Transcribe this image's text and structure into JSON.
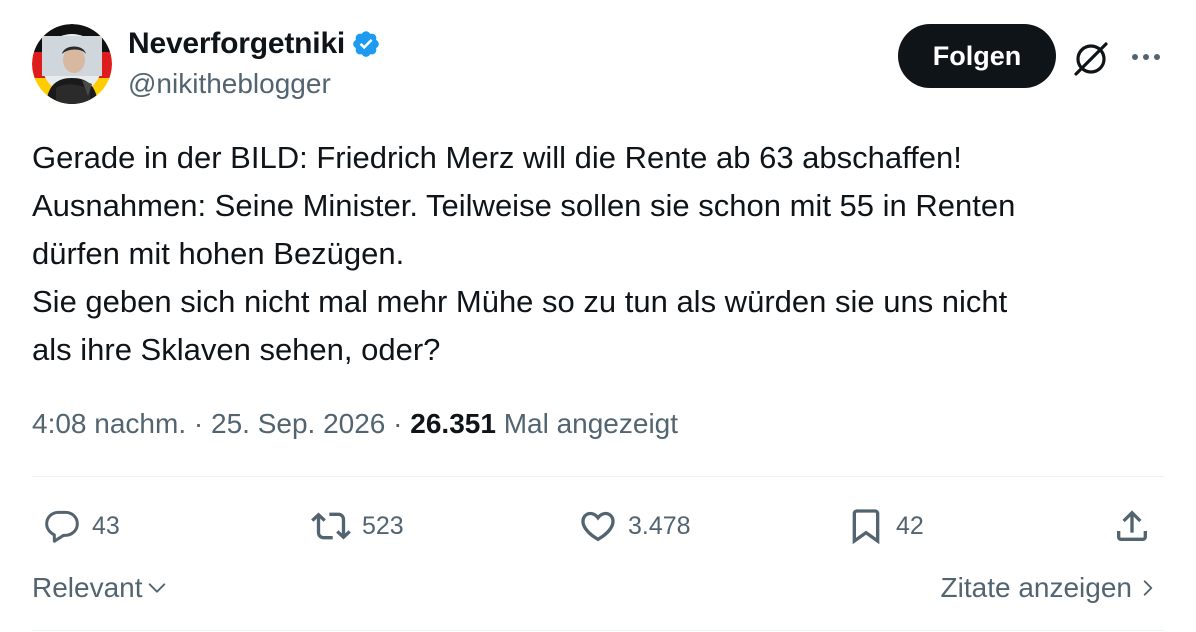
{
  "author": {
    "display_name": "Neverforgetniki",
    "handle": "@nikitheblogger",
    "verified": true,
    "avatar_icon": "user-avatar-photo"
  },
  "header": {
    "follow_label": "Folgen",
    "grok_icon": "grok-icon",
    "more_icon": "more-horizontal-icon"
  },
  "tweet": {
    "lines": [
      "Gerade in der BILD: Friedrich Merz will die Rente ab 63 abschaffen!",
      "Ausnahmen: Seine Minister. Teilweise sollen sie schon mit 55 in Renten",
      "dürfen mit hohen Bezügen.",
      "Sie geben sich nicht mal mehr Mühe so zu tun als würden sie uns nicht",
      "als ihre Sklaven sehen, oder?"
    ]
  },
  "meta": {
    "time": "4:08 nachm.",
    "separator": "·",
    "date": "25. Sep. 2026",
    "views_count": "26.351",
    "views_label": "Mal angezeigt"
  },
  "actions": {
    "reply": {
      "icon": "reply-icon",
      "count": "43"
    },
    "retweet": {
      "icon": "retweet-icon",
      "count": "523"
    },
    "like": {
      "icon": "heart-icon",
      "count": "3.478"
    },
    "bookmark": {
      "icon": "bookmark-icon",
      "count": "42"
    },
    "share": {
      "icon": "share-icon"
    }
  },
  "footer": {
    "sort_label": "Relevant",
    "quotes_label": "Zitate anzeigen"
  },
  "colors": {
    "verified_blue": "#1d9bf0",
    "text_primary": "#0f1419",
    "text_secondary": "#536471",
    "divider": "#eff3f4"
  }
}
